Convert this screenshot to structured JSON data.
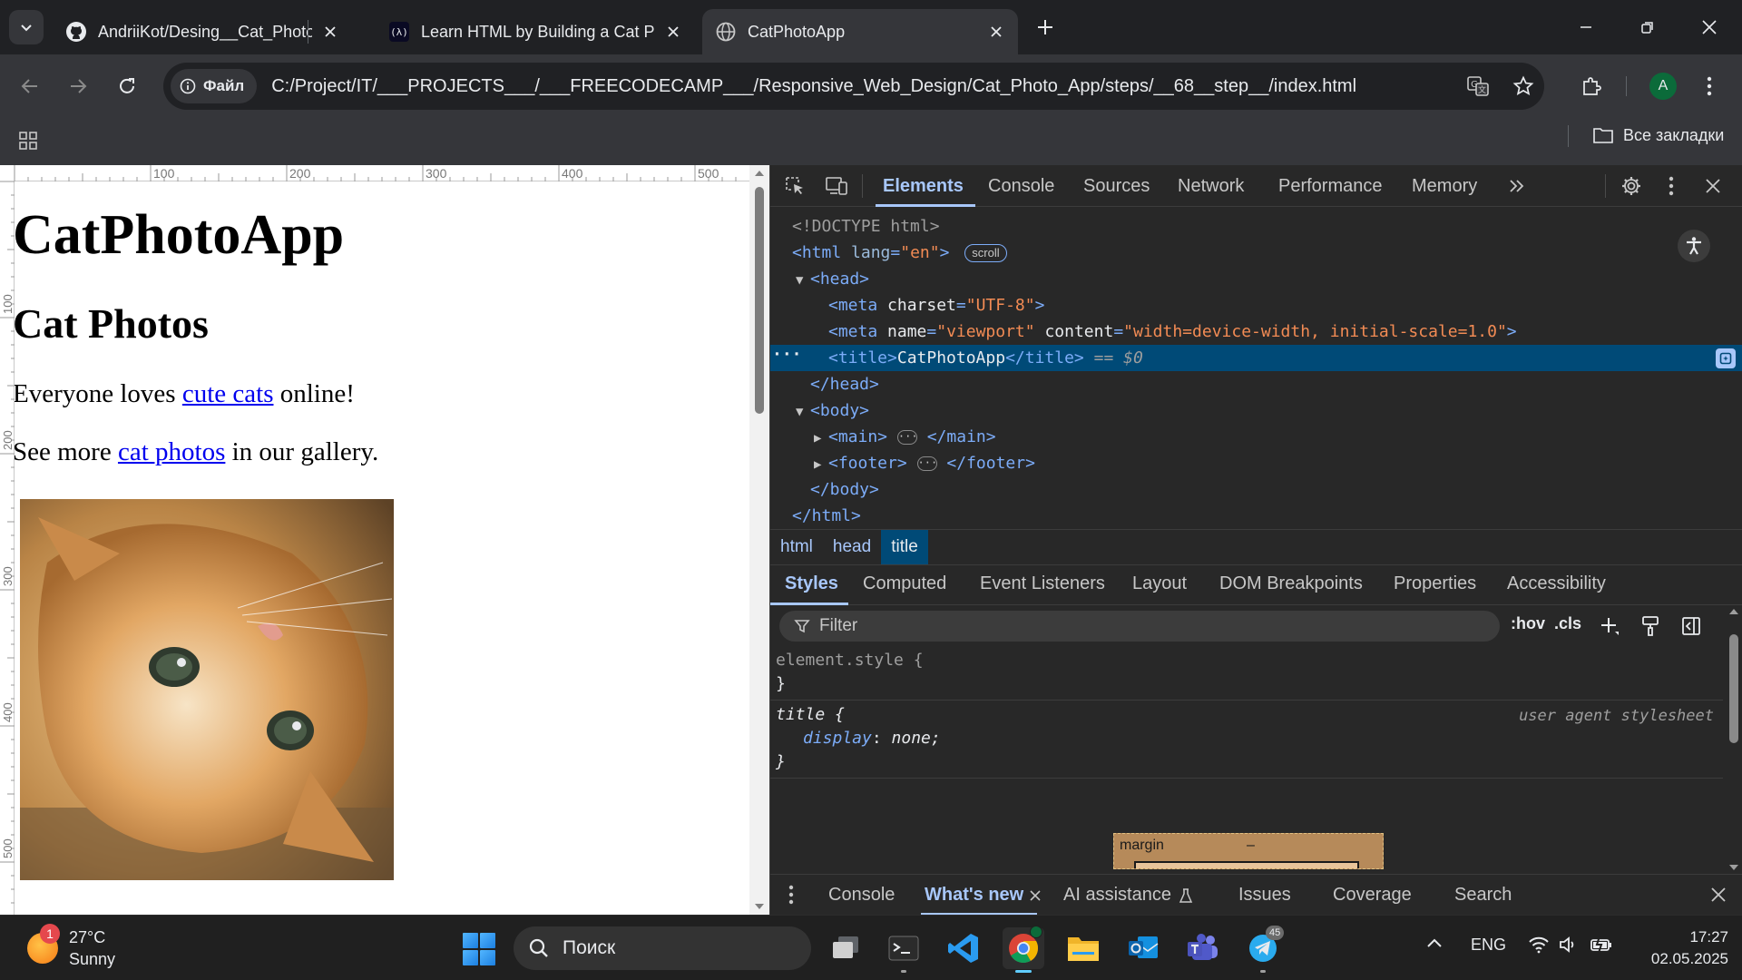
{
  "browser": {
    "tabs": [
      {
        "title": "AndriiKot/Desing__Cat_Photo_",
        "icon": "github-icon",
        "active": false
      },
      {
        "title": "Learn HTML by Building a Cat P",
        "icon": "freecodecamp-icon",
        "active": false
      },
      {
        "title": "CatPhotoApp",
        "icon": "globe-icon",
        "active": true
      }
    ],
    "site_chip": "Файл",
    "url": "C:/Project/IT/___PROJECTS___/___FREECODECAMP___/Responsive_Web_Design/Cat_Photo_App/steps/__68__step__/index.html",
    "profile_initial": "A",
    "all_bookmarks": "Все закладки"
  },
  "page": {
    "h1": "CatPhotoApp",
    "h2": "Cat Photos",
    "p1_before": "Everyone loves ",
    "p1_link": "cute cats",
    "p1_after": " online!",
    "p2_before": "See more ",
    "p2_link": "cat photos",
    "p2_after": " in our gallery.",
    "ruler_top": [
      "100",
      "200",
      "300",
      "400",
      "500"
    ],
    "ruler_left": [
      "100",
      "200",
      "300",
      "400",
      "500"
    ]
  },
  "devtools": {
    "tabs": [
      "Elements",
      "Console",
      "Sources",
      "Network",
      "Performance",
      "Memory"
    ],
    "active_tab": "Elements",
    "dom": {
      "doctype": "<!DOCTYPE html>",
      "html_open": "<html",
      "html_lang_attr": "lang",
      "html_lang_val": "\"en\"",
      "scroll_badge": "scroll",
      "head_open": "<head>",
      "meta1_tag": "<meta",
      "meta1_attr": "charset",
      "meta1_val": "\"UTF-8\"",
      "meta2_tag": "<meta",
      "meta2_attr1": "name",
      "meta2_val1": "\"viewport\"",
      "meta2_attr2": "content",
      "meta2_val2": "\"width=device-width, initial-scale=1.0\"",
      "title_open": "<title>",
      "title_text": "CatPhotoApp",
      "title_close": "</title>",
      "selected_marker": "== $0",
      "head_close": "</head>",
      "body_open": "<body>",
      "main_open": "<main>",
      "main_close": "</main>",
      "footer_open": "<footer>",
      "footer_close": "</footer>",
      "body_close": "</body>",
      "html_close": "</html>"
    },
    "breadcrumbs": [
      "html",
      "head",
      "title"
    ],
    "sub_tabs": [
      "Styles",
      "Computed",
      "Event Listeners",
      "Layout",
      "DOM Breakpoints",
      "Properties",
      "Accessibility"
    ],
    "filter_placeholder": "Filter",
    "hov_label": ":hov",
    "cls_label": ".cls",
    "styles": {
      "element_style": "element.style {",
      "close_brace": "}",
      "title_selector": "title {",
      "ua_origin": "user agent stylesheet",
      "prop_name": "display",
      "prop_value": "none;"
    },
    "box_model": {
      "label": "margin",
      "value": "–"
    },
    "drawer_tabs": [
      "Console",
      "What's new",
      "AI assistance",
      "Issues",
      "Coverage",
      "Search"
    ]
  },
  "taskbar": {
    "weather_badge": "1",
    "temperature": "27°C",
    "condition": "Sunny",
    "search_placeholder": "Поиск",
    "telegram_badge": "45",
    "lang": "ENG",
    "time": "17:27",
    "date": "02.05.2025"
  },
  "colors": {
    "devtools_accent": "#a8c7fa",
    "selected_row": "#004a77",
    "link": "#0000ee"
  }
}
